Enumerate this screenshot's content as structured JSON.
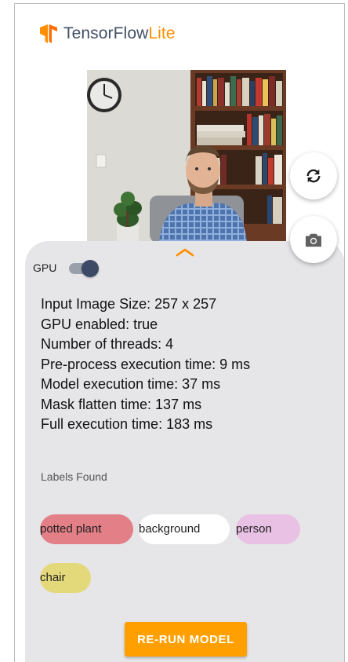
{
  "header": {
    "brand_name": "TensorFlow",
    "brand_accent": "Lite",
    "logo_icon": "tensorflow-logo-icon"
  },
  "camera": {
    "switch_icon": "camera-switch-icon",
    "capture_icon": "camera-icon"
  },
  "panel": {
    "gpu_label": "GPU",
    "gpu_enabled": true,
    "stats": [
      "Input Image Size: 257 x 257",
      "GPU enabled: true",
      "Number of threads: 4",
      "Pre-process execution time: 9 ms",
      "Model execution time: 37 ms",
      "Mask flatten time: 137 ms",
      "Full execution time: 183 ms"
    ],
    "labels_title": "Labels Found",
    "labels": [
      {
        "text": "potted plant",
        "color": "#e27f87"
      },
      {
        "text": "background",
        "color": "#ffffff"
      },
      {
        "text": "person",
        "color": "#e8c1e4"
      },
      {
        "text": "chair",
        "color": "#e4d97a"
      }
    ],
    "rerun_label": "RE-RUN MODEL"
  },
  "colors": {
    "accent": "#ffa000",
    "brand_text": "#425066",
    "brand_accent": "#ff8f00",
    "sheet_bg": "#e6e5e8"
  }
}
